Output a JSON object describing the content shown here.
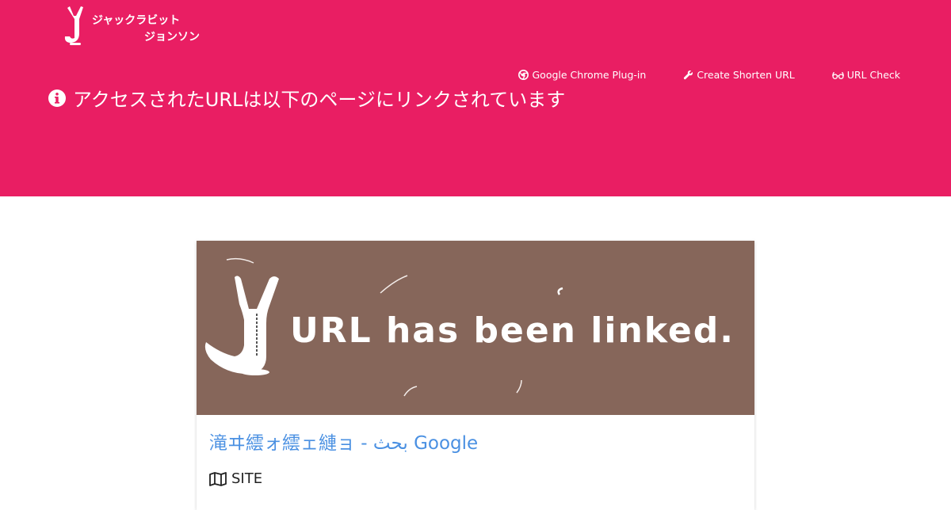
{
  "logo": {
    "line1": "ジャックラビット",
    "line2": "ジョンソン"
  },
  "nav": {
    "items": [
      {
        "label": "Google Chrome Plug-in",
        "icon": "chrome-icon"
      },
      {
        "label": "Create Shorten URL",
        "icon": "wrench-icon"
      },
      {
        "label": "URL Check",
        "icon": "glasses-icon"
      }
    ]
  },
  "hero": {
    "message": "アクセスされたURLは以下のページにリンクされています",
    "icon": "info-icon"
  },
  "card": {
    "banner_text": "URL has been linked.",
    "title": "滝ヰ繧ォ繧ェ縺ョ - بحث Google",
    "meta_icon": "map-icon",
    "meta_label": "SITE"
  },
  "colors": {
    "header_bg": "#e91e63",
    "banner_bg": "#86665a",
    "title_link": "#4a90e2"
  }
}
